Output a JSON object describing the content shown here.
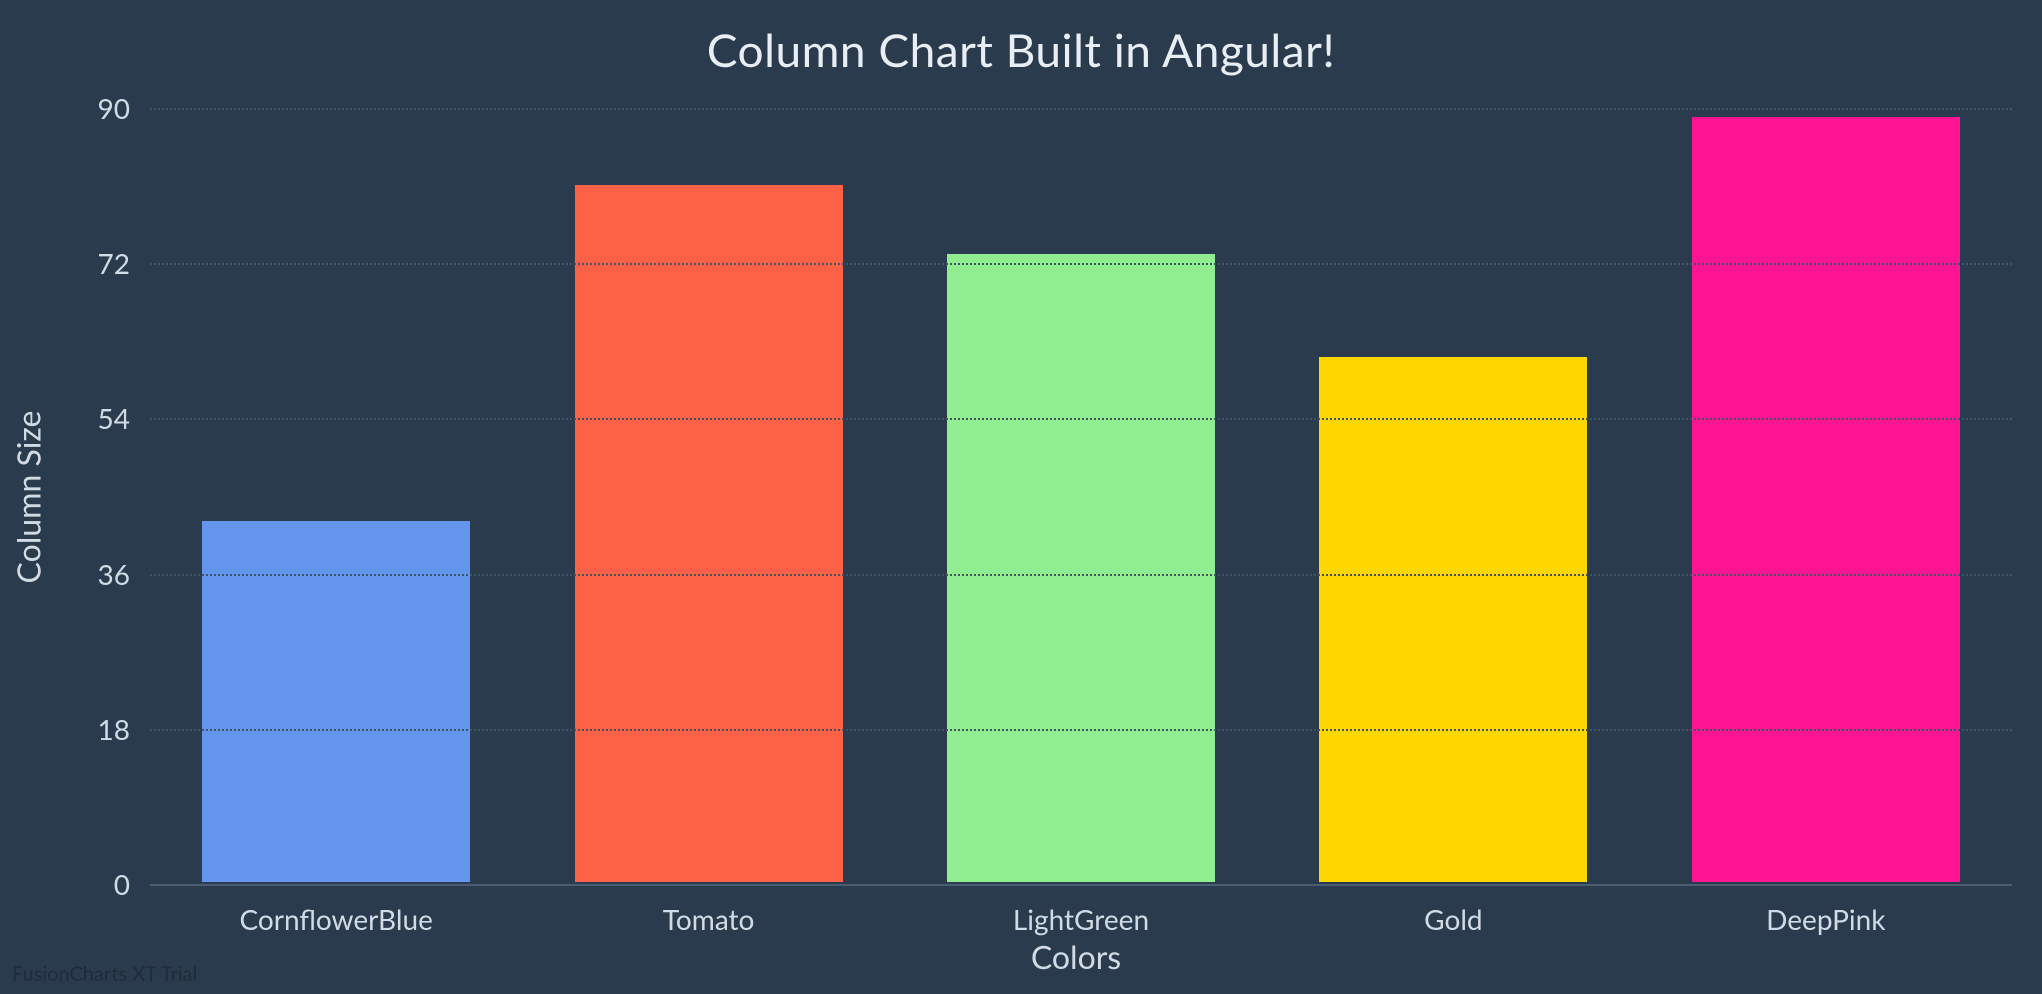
{
  "chart_data": {
    "type": "bar",
    "title": "Column Chart Built in Angular!",
    "xlabel": "Colors",
    "ylabel": "Column Size",
    "ylim": [
      0,
      90
    ],
    "yticks": [
      0,
      18,
      36,
      54,
      72,
      90
    ],
    "categories": [
      "CornflowerBlue",
      "Tomato",
      "LightGreen",
      "Gold",
      "DeepPink"
    ],
    "values": [
      42,
      81,
      73,
      61,
      89
    ],
    "colors": [
      "#6495ed",
      "#ff6347",
      "#90ee90",
      "#ffd700",
      "#ff1493"
    ]
  },
  "watermark": "FusionCharts XT Trial"
}
